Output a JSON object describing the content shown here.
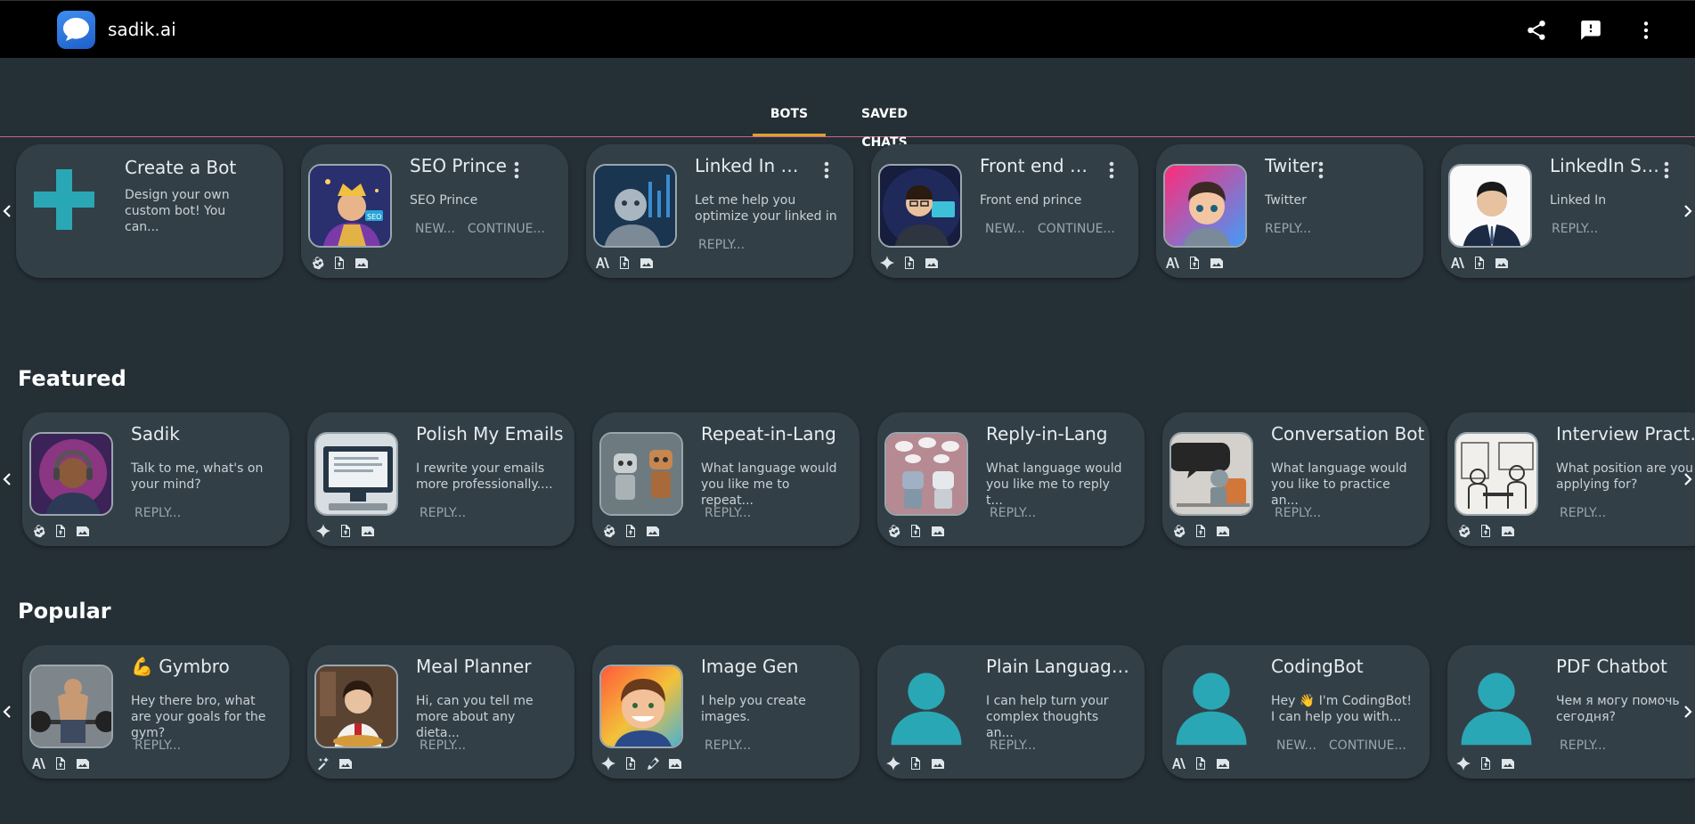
{
  "app": {
    "title": "sadik.ai"
  },
  "tabs": [
    {
      "label": "BOTS"
    },
    {
      "label": "SAVED CHATS"
    }
  ],
  "sections": {
    "featured": "Featured",
    "popular": "Popular"
  },
  "my_bots": {
    "create": {
      "name": "Create a Bot",
      "desc": "Design your own custom bot! You can..."
    },
    "cards": [
      {
        "name": "SEO Prince",
        "desc": "SEO Prince",
        "a1": "NEW...",
        "a2": "CONTINUE..."
      },
      {
        "name": "Linked In Opt...",
        "desc": "Let me help you optimize your linked in",
        "a1": "REPLY..."
      },
      {
        "name": "Front end pri...",
        "desc": "Front end prince",
        "a1": "NEW...",
        "a2": "CONTINUE..."
      },
      {
        "name": "Twiter",
        "desc": "Twitter",
        "a1": "REPLY..."
      },
      {
        "name": "LinkedIn SEO",
        "desc": "Linked In",
        "a1": "REPLY..."
      }
    ]
  },
  "featured": [
    {
      "name": "Sadik",
      "desc": "Talk to me, what's on your mind?",
      "a1": "REPLY..."
    },
    {
      "name": "Polish My Emails",
      "desc": "I rewrite your emails more professionally....",
      "a1": "REPLY..."
    },
    {
      "name": "Repeat-in-Lang",
      "desc": "What language would you like me to repeat...",
      "a1": "REPLY..."
    },
    {
      "name": "Reply-in-Lang",
      "desc": "What language would you like me to reply t...",
      "a1": "REPLY..."
    },
    {
      "name": "Conversation Bot",
      "desc": "What language would you like to practice an...",
      "a1": "REPLY..."
    },
    {
      "name": "Interview Practice",
      "desc": "What position are you applying for?",
      "a1": "REPLY..."
    }
  ],
  "popular": [
    {
      "name": "💪 Gymbro",
      "desc": "Hey there bro, what are your goals for the gym?",
      "a1": "REPLY..."
    },
    {
      "name": "Meal Planner",
      "desc": "Hi, can you tell me more about any dieta...",
      "a1": "REPLY..."
    },
    {
      "name": "Image Gen",
      "desc": "I help you create images.",
      "a1": "REPLY..."
    },
    {
      "name": "Plain Language S...",
      "desc": "I can help turn your complex thoughts an...",
      "a1": "REPLY..."
    },
    {
      "name": "CodingBot",
      "desc": "Hey 👋 I'm CodingBot! I can help you with...",
      "a1": "NEW...",
      "a2": "CONTINUE..."
    },
    {
      "name": "PDF Chatbot",
      "desc": "Чем я могу помочь сегодня?",
      "a1": "REPLY..."
    }
  ],
  "colors": {
    "background": "#252f36",
    "card": "#333f47",
    "appbar": "#000000",
    "accent_teal": "#2aa7b4",
    "tab_indicator": "#e0a030"
  }
}
